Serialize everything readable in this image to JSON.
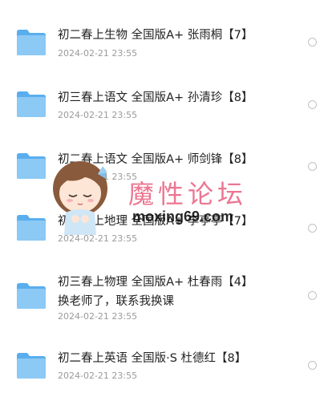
{
  "files": [
    {
      "title": "初二春上生物 全国版A+ 张雨桐【7】",
      "date": "2024-02-21 23:55"
    },
    {
      "title": "初三春上语文 全国版A+ 孙清珍【8】",
      "date": "2024-02-21 23:55"
    },
    {
      "title": "初二春上语文 全国版A+ 师剑锋【8】",
      "date": "2024-02-21 23:55"
    },
    {
      "title": "初二春上地理 全国版A+ 李亭亭【7】",
      "date": "2024-02-21 23:55"
    },
    {
      "title": "初三春上物理 全国版A+ 杜春雨【4】\n换老师了，联系我换课",
      "date": "2024-02-21 23:55"
    },
    {
      "title": "初二春上英语 全国版·S 杜德红【8】",
      "date": "2024-02-21 23:55"
    }
  ],
  "watermark": {
    "title": "魔性论坛",
    "url": "moxing69.com"
  },
  "colors": {
    "folder": "#7fc1f3",
    "folder_dark": "#5aaeee",
    "accent": "#ea6b88"
  }
}
